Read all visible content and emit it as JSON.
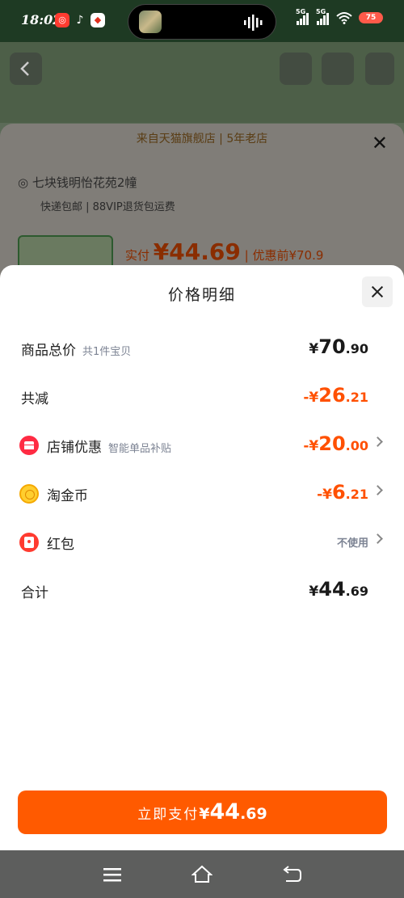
{
  "status_bar": {
    "time": "18:02",
    "network_1": "5G",
    "network_2": "5G",
    "battery": "75",
    "icons": [
      "weibo-icon",
      "tiktok-icon",
      "app-icon",
      "wifi-icon"
    ]
  },
  "background": {
    "store_banner": "来自天猫旗舰店 | 5年老店",
    "address": "七块钱明怡花苑2幢",
    "delivery": "快递包邮 | 88VIP退货包运费",
    "pay_label": "实付",
    "pay_amount": "¥44.69",
    "before_discount": "| 优惠前¥70.9"
  },
  "modal": {
    "title": "价格明细",
    "rows": [
      {
        "label": "商品总价",
        "sub": "共1件宝贝",
        "cur": "¥",
        "int": "70",
        "dec": ".90",
        "color": "#1a1a1a"
      },
      {
        "label": "共减",
        "sub": "",
        "cur": "-¥",
        "int": "26",
        "dec": ".21",
        "color": "#ff5000"
      },
      {
        "label": "店铺优惠",
        "sub": "智能单品补贴",
        "cur": "-¥",
        "int": "20",
        "dec": ".00",
        "color": "#ff5000",
        "icon": "store-coupon-icon"
      },
      {
        "label": "淘金币",
        "sub": "",
        "cur": "-¥",
        "int": "6",
        "dec": ".21",
        "color": "#ff5000",
        "icon": "gold-coin-icon"
      },
      {
        "label": "红包",
        "sub": "",
        "value_text": "不使用",
        "icon": "red-packet-icon"
      },
      {
        "label": "合计",
        "sub": "",
        "cur": "¥",
        "int": "44",
        "dec": ".69",
        "color": "#1a1a1a"
      }
    ],
    "pay_button": {
      "label": "立即支付",
      "cur": "¥",
      "int": "44",
      "dec": ".69"
    }
  },
  "colors": {
    "accent": "#ff5a00",
    "discount": "#ff5000",
    "muted": "#7c8393",
    "dark_green": "#1e3a23"
  }
}
